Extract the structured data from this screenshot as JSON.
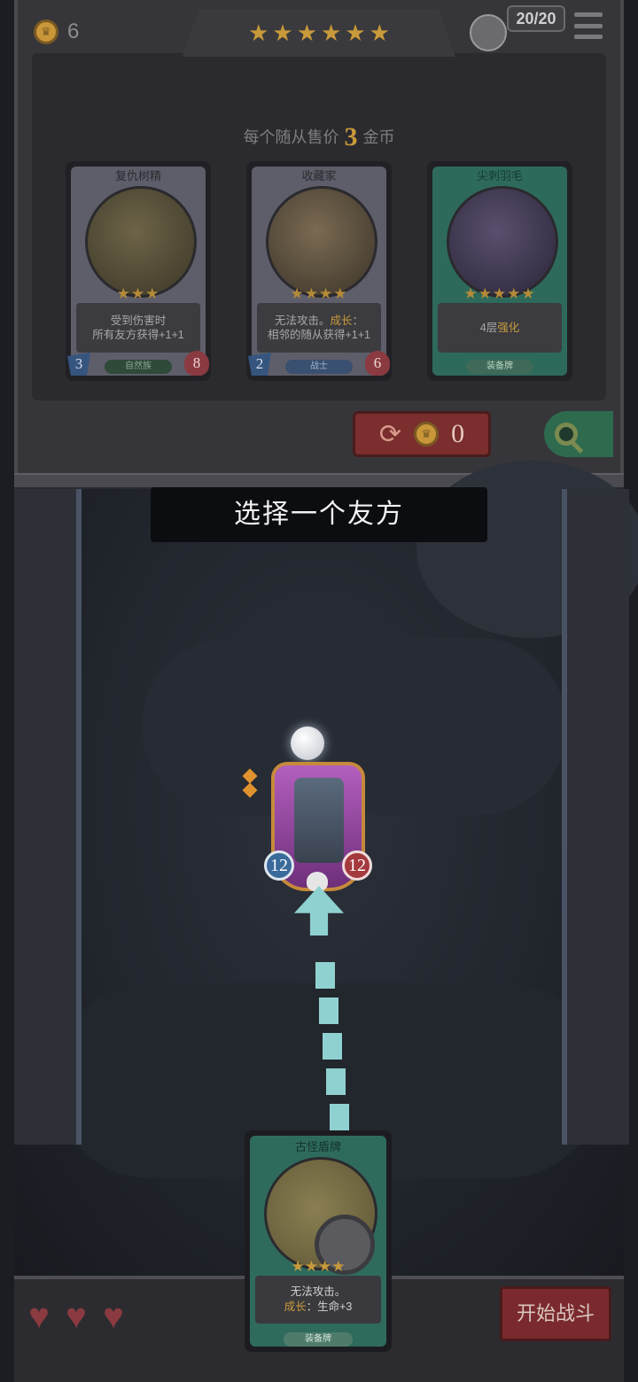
{
  "top_bar": {
    "gold": "6",
    "tier_stars": [
      "★",
      "★",
      "★",
      "★",
      "★",
      "★"
    ],
    "health": "20/20",
    "colors": {
      "gold": "#c99a3a",
      "panel": "#36363a"
    }
  },
  "shop": {
    "sell_prefix": "每个随从售价",
    "sell_value": "3",
    "sell_suffix": "金币",
    "cards": [
      {
        "title": "复仇树精",
        "stars": "★★★",
        "text1": "受到伤害时",
        "text2": "所有友方获得+1+1",
        "tag": "自然族",
        "attack": "3",
        "health": "8"
      },
      {
        "title": "收藏家",
        "stars": "★★★★",
        "text1a": "无法攻击。",
        "text1b": "成长",
        "text1c": "：",
        "text2": "相邻的随从获得+1+1",
        "tag": "战士",
        "attack": "2",
        "health": "6"
      },
      {
        "title": "尖刺羽毛",
        "stars": "★★★★★",
        "text1a": "4层",
        "text1b": "强化",
        "tag": "装备牌"
      }
    ],
    "refresh_cost": "0"
  },
  "board": {
    "prompt": "选择一个友方",
    "minion": {
      "attack": "12",
      "health": "12",
      "icon": "robot-minion"
    }
  },
  "hand_card": {
    "title": "古怪盾牌",
    "stars": "★★★★",
    "line1": "无法攻击。",
    "line2_label": "成长",
    "line2_rest": "：生命+3",
    "tag": "装备牌"
  },
  "bottom": {
    "lives": [
      "♥",
      "♥",
      "♥"
    ],
    "start_button": "开始战斗"
  }
}
